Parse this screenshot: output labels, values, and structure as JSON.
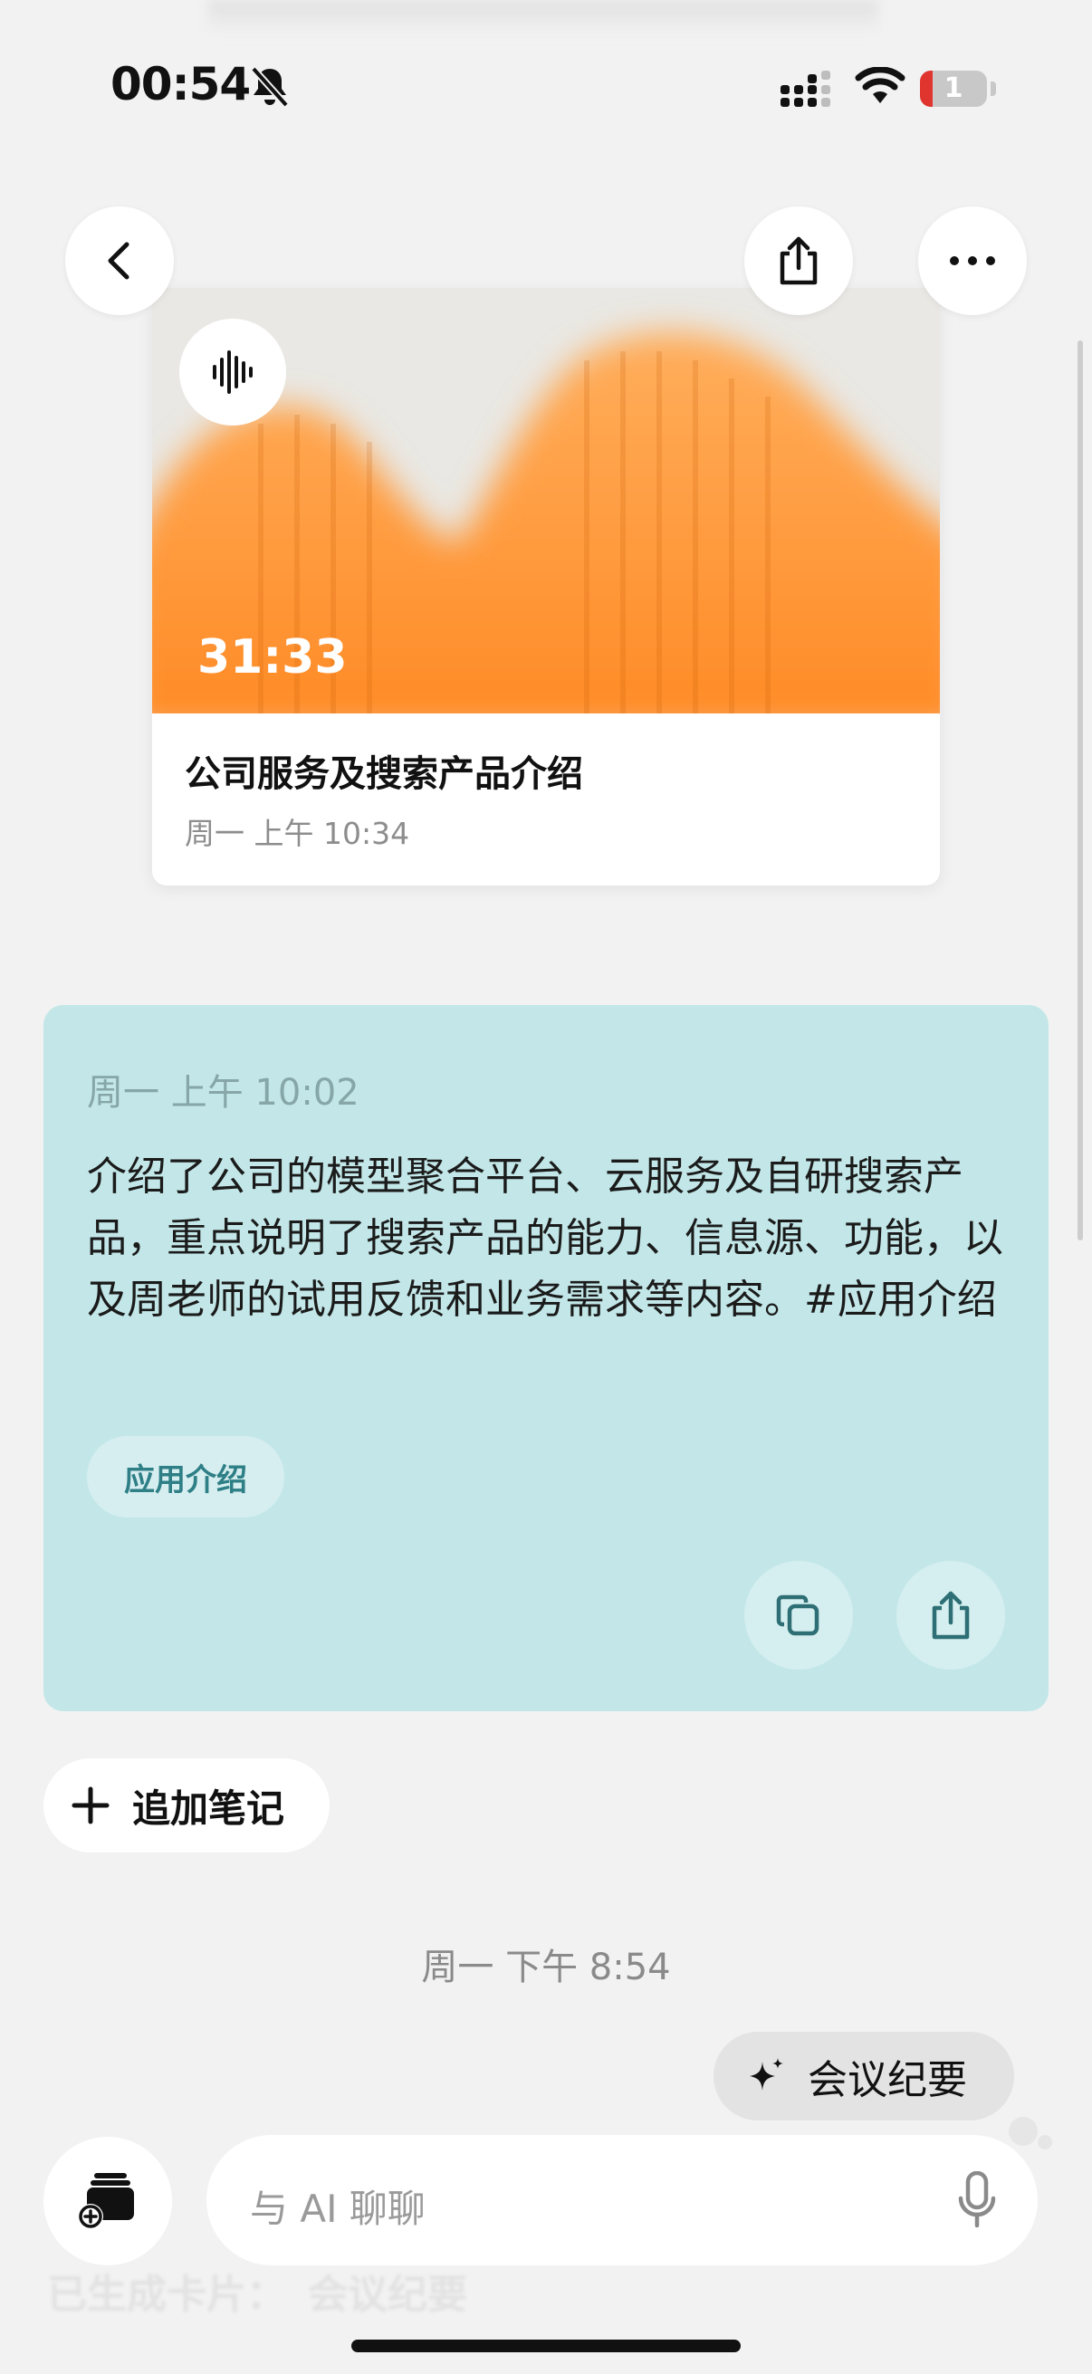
{
  "status_bar": {
    "time": "00:54",
    "battery_level": "1"
  },
  "header": {
    "back_icon": "chevron-left-icon",
    "share_icon": "share-icon",
    "more_icon": "more-horizontal-icon"
  },
  "media_card": {
    "duration": "31:33",
    "title": "公司服务及搜索产品介绍",
    "datetime": "周一 上午 10:34",
    "accent_color": "#ff9a3c"
  },
  "note_card": {
    "datetime": "周一 上午 10:02",
    "body": "介绍了公司的模型聚合平台、云服务及自研搜索产品，重点说明了搜索产品的能力、信息源、功能，以及周老师的试用反馈和业务需求等内容。#应用介绍",
    "tag": "应用介绍",
    "background_color": "#c3e7e8"
  },
  "add_note": {
    "label": "追加笔记"
  },
  "day_stamp": "周一 下午 8:54",
  "summary_chip": {
    "label": "会议纪要"
  },
  "chat_input": {
    "placeholder": "与 AI 聊聊"
  },
  "ghost_bar": {
    "prefix": "已生成卡片：",
    "value": "会议纪要"
  }
}
